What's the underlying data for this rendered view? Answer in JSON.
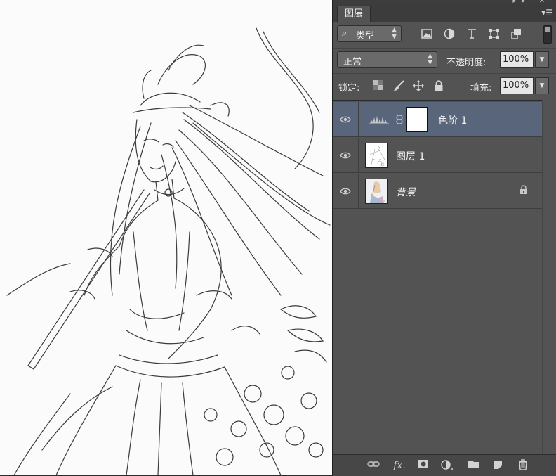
{
  "panel": {
    "tab_label": "图层",
    "filter": {
      "label": "类型",
      "icon": "search-icon"
    },
    "filter_icons": [
      "image-filter-icon",
      "adjustment-filter-icon",
      "text-filter-icon",
      "shape-filter-icon",
      "smart-object-filter-icon"
    ],
    "blend_mode": "正常",
    "opacity_label": "不透明度:",
    "opacity_value": "100%",
    "lock_label": "锁定:",
    "lock_icons": [
      "lock-transparent-icon",
      "lock-paint-icon",
      "lock-position-icon",
      "lock-all-icon"
    ],
    "fill_label": "填充:",
    "fill_value": "100%"
  },
  "layers": [
    {
      "name": "色阶 1",
      "type": "adjustment-levels",
      "selected": true,
      "visible": true,
      "locked": false
    },
    {
      "name": "图层 1",
      "type": "pixel",
      "selected": false,
      "visible": true,
      "locked": false
    },
    {
      "name": "背景",
      "type": "background",
      "selected": false,
      "visible": true,
      "locked": true
    }
  ],
  "bottom_icons": [
    "link-layers-icon",
    "fx-icon",
    "add-mask-icon",
    "new-adjustment-icon",
    "new-group-icon",
    "new-layer-icon",
    "trash-icon"
  ],
  "colors": {
    "panel_bg": "#535353",
    "selected_row": "#58657a",
    "canvas_bg": "#fbfbfb"
  }
}
